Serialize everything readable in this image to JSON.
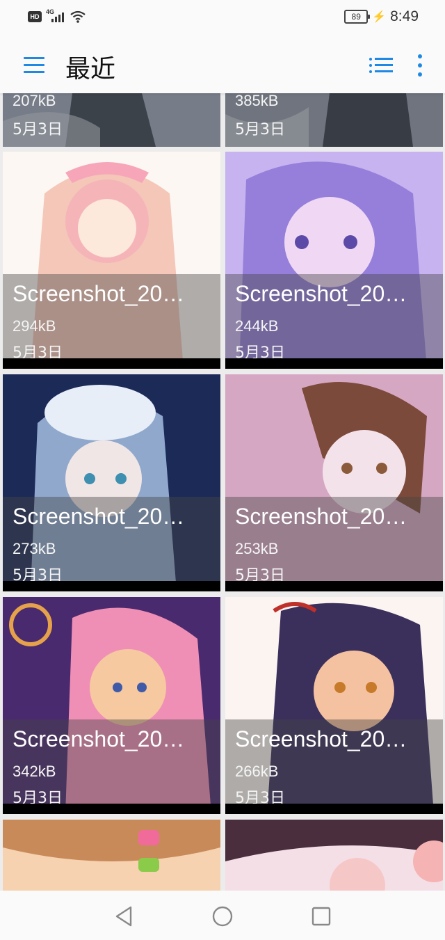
{
  "status_bar": {
    "network": "4G",
    "time": "8:49",
    "battery": "89",
    "hd_label": "HD"
  },
  "app_bar": {
    "title": "最近"
  },
  "gallery": {
    "top_row": [
      {
        "size": "207kB",
        "date": "5月3日",
        "palette": [
          "#9aa4b8",
          "#36404f",
          "#c9d0dc"
        ]
      },
      {
        "size": "385kB",
        "date": "5月3日",
        "palette": [
          "#8d97a8",
          "#2f3845",
          "#d0d6e0"
        ]
      }
    ],
    "items": [
      {
        "name": "Screenshot_20…",
        "size": "294kB",
        "date": "5月3日",
        "palette": [
          "#fdf7f3",
          "#f4c7b8",
          "#f6a6b8"
        ]
      },
      {
        "name": "Screenshot_20…",
        "size": "244kB",
        "date": "5月3日",
        "palette": [
          "#c7b3f0",
          "#8c76d6",
          "#f0d8f4"
        ]
      },
      {
        "name": "Screenshot_20…",
        "size": "273kB",
        "date": "5月3日",
        "palette": [
          "#1c2a57",
          "#8fa8cc",
          "#e8eef8"
        ]
      },
      {
        "name": "Screenshot_20…",
        "size": "253kB",
        "date": "5月3日",
        "palette": [
          "#d6a7c3",
          "#7b4a3a",
          "#f4e2ea"
        ]
      },
      {
        "name": "Screenshot_20…",
        "size": "342kB",
        "date": "5月3日",
        "palette": [
          "#4a2a6e",
          "#f08fb6",
          "#f6c9a0"
        ]
      },
      {
        "name": "Screenshot_20…",
        "size": "266kB",
        "date": "5月3日",
        "palette": [
          "#fbf4f1",
          "#3b2f5c",
          "#f4c2a0"
        ]
      }
    ],
    "bottom_row": [
      {
        "palette": [
          "#f6d2b0",
          "#c98a5a",
          "#f06a9a"
        ]
      },
      {
        "palette": [
          "#f4dfe6",
          "#4a2e3e",
          "#f6c7c7"
        ]
      }
    ]
  },
  "nav_bar": {
    "back": "back-button",
    "home": "home-button",
    "recents": "recents-button"
  }
}
